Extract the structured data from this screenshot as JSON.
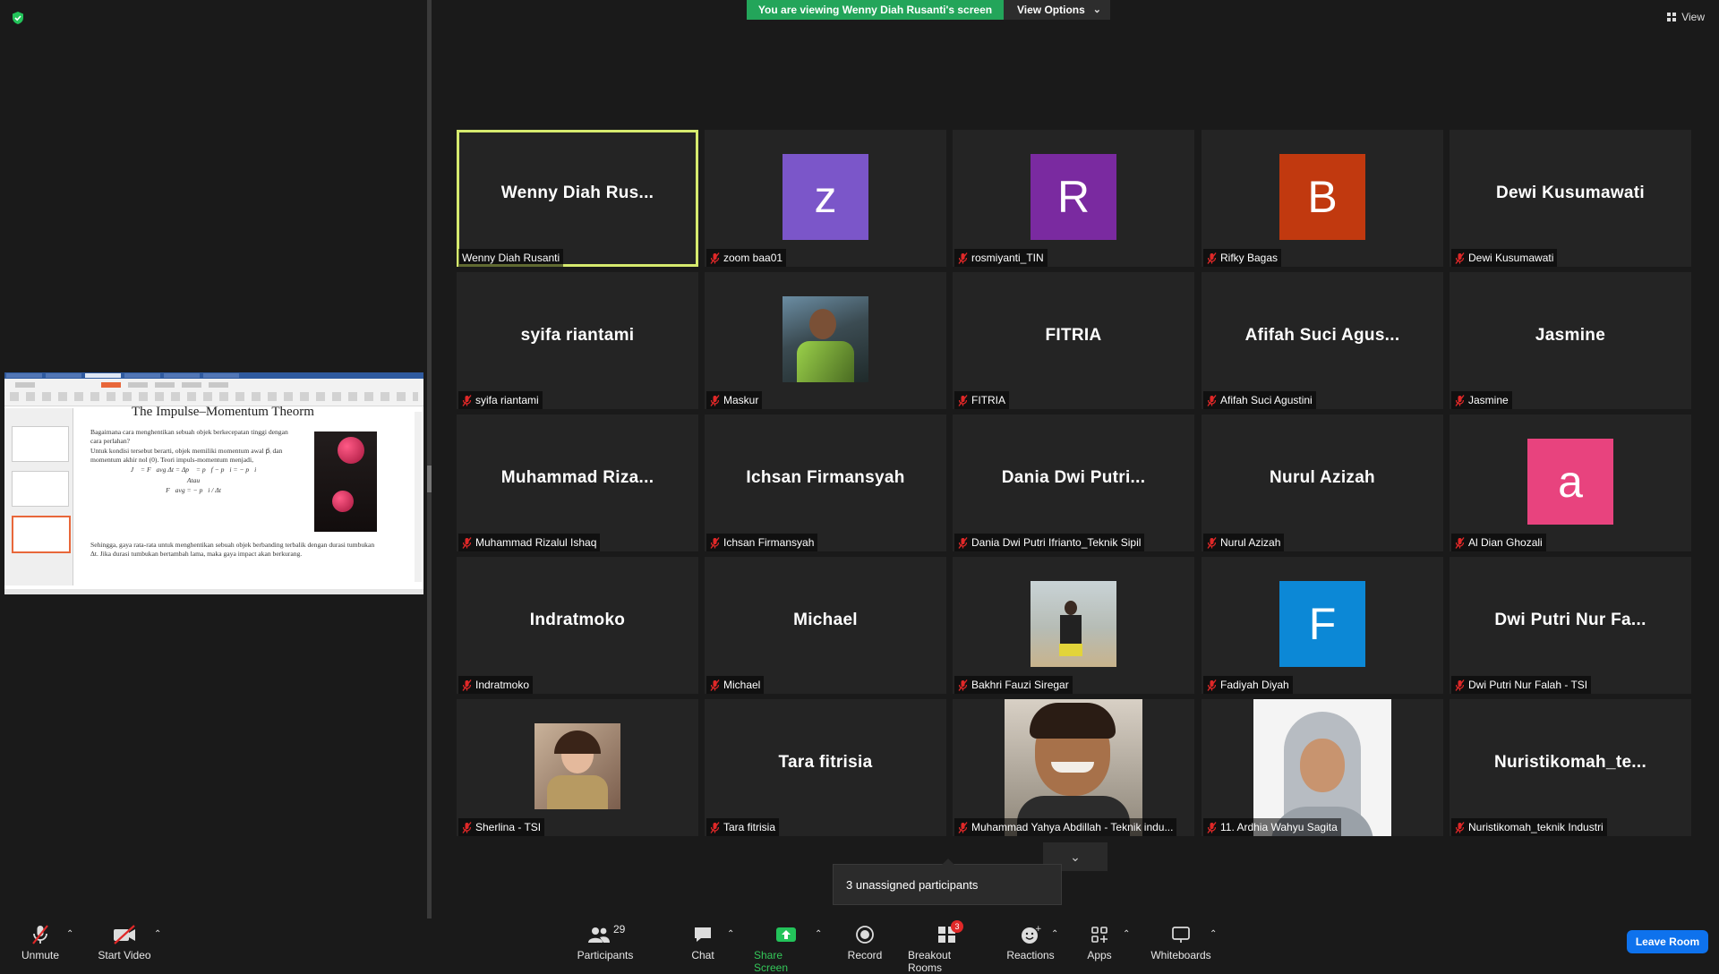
{
  "banner": {
    "viewing_text": "You are viewing Wenny Diah Rusanti's screen",
    "view_options_label": "View Options"
  },
  "view_button_label": "View",
  "shared_slide": {
    "title": "The Impulse–Momentum Theorm",
    "bullet1": "Bagaimana cara menghentikan sebuah objek berkecepatan tinggi dengan cara perlahan?",
    "bullet2": "Untuk kondisi tersebut berarti, objek memiliki momentum awal p⃗ᵢ dan momentum akhir nol (0). Teori impuls-momentum menjadi,",
    "formula1": "J⃗ = F⃗avg Δt = Δp⃗ = p⃗f − p⃗i = − p⃗i",
    "formula_or": "Atau",
    "formula2": "F⃗avg = − p⃗i / Δt",
    "bullet3": "Sehingga, gaya rata-rata untuk menghentikan sebuah objek berbanding terbalik dengan durasi tumbukan Δt. Jika durasi tumbukan bertambah lama, maka gaya impact akan berkurang."
  },
  "participants": [
    {
      "big": "Wenny  Diah  Rus...",
      "tag": "Wenny Diah Rusanti",
      "muted": false,
      "active": true
    },
    {
      "avatar": "z",
      "avatar_color": "#7b56c9",
      "tag": "zoom baa01",
      "muted": true
    },
    {
      "avatar": "R",
      "avatar_color": "#7a2aa0",
      "tag": "rosmiyanti_TIN",
      "muted": true
    },
    {
      "avatar": "B",
      "avatar_color": "#c1390f",
      "tag": "Rifky Bagas",
      "muted": true
    },
    {
      "big": "Dewi Kusumawati",
      "tag": "Dewi Kusumawati",
      "muted": true
    },
    {
      "big": "syifa riantami",
      "tag": "syifa riantami",
      "muted": true
    },
    {
      "photo": "photo-maskur",
      "tag": "Maskur",
      "muted": true
    },
    {
      "big": "FITRIA",
      "tag": "FITRIA",
      "muted": true
    },
    {
      "big": "Afifah  Suci  Agus...",
      "tag": "Afifah Suci Agustini",
      "muted": true
    },
    {
      "big": "Jasmine",
      "tag": "Jasmine",
      "muted": true
    },
    {
      "big": "Muhammad  Riza...",
      "tag": "Muhammad Rizalul Ishaq",
      "muted": true
    },
    {
      "big": "Ichsan Firmansyah",
      "tag": "Ichsan Firmansyah",
      "muted": true
    },
    {
      "big": "Dania  Dwi  Putri...",
      "tag": "Dania Dwi Putri Ifrianto_Teknik Sipil",
      "muted": true
    },
    {
      "big": "Nurul Azizah",
      "tag": "Nurul Azizah",
      "muted": true
    },
    {
      "avatar": "a",
      "avatar_color": "#e8437e",
      "tag": "Al Dian Ghozali",
      "muted": true
    },
    {
      "big": "Indratmoko",
      "tag": "Indratmoko",
      "muted": true
    },
    {
      "big": "Michael",
      "tag": "Michael",
      "muted": true
    },
    {
      "photo": "photo-bakhri",
      "tag": "Bakhri Fauzi Siregar",
      "muted": true
    },
    {
      "avatar": "F",
      "avatar_color": "#0c88d6",
      "tag": "Fadiyah Diyah",
      "muted": true
    },
    {
      "big": "Dwi  Putri  Nur  Fa...",
      "tag": "Dwi Putri Nur Falah - TSI",
      "muted": true
    },
    {
      "photo": "photo-sherlina",
      "tag": "Sherlina - TSI",
      "muted": true
    },
    {
      "big": "Tara fitrisia",
      "tag": "Tara fitrisia",
      "muted": true
    },
    {
      "bigphoto": "photo-yahya",
      "tag": "Muhammad Yahya Abdillah - Teknik indu...",
      "muted": true
    },
    {
      "bigphoto": "photo-ardhia",
      "tag": "11. Ardhia Wahyu Sagita",
      "muted": true
    },
    {
      "big": "Nuristikomah_te...",
      "tag": "Nuristikomah_teknik Industri",
      "muted": true
    }
  ],
  "unassigned_text": "3 unassigned participants",
  "toolbar": {
    "unmute": "Unmute",
    "start_video": "Start Video",
    "participants": "Participants",
    "participants_count": "29",
    "chat": "Chat",
    "share_screen": "Share Screen",
    "record": "Record",
    "breakout_rooms": "Breakout Rooms",
    "breakout_badge": "3",
    "reactions": "Reactions",
    "apps": "Apps",
    "whiteboards": "Whiteboards",
    "leave_room": "Leave Room"
  },
  "colors": {
    "active_speaker_border": "#d6ea6e",
    "banner_green": "#23a55a",
    "leave_blue": "#0e72ed",
    "mute_red": "#e02828"
  }
}
